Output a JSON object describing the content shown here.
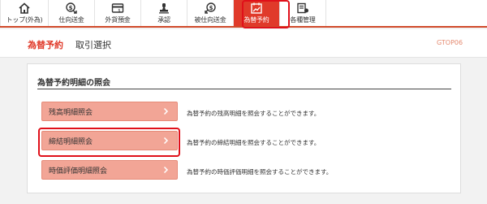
{
  "nav": {
    "items": [
      {
        "label": "トップ(外為)",
        "icon": "home-icon"
      },
      {
        "label": "仕向送金",
        "icon": "dollar-arrow-icon"
      },
      {
        "label": "外貨預金",
        "icon": "card-icon"
      },
      {
        "label": "承認",
        "icon": "stamp-icon"
      },
      {
        "label": "被仕向送金",
        "icon": "dollar-in-icon"
      },
      {
        "label": "為替予約",
        "icon": "calendar-chart-icon"
      },
      {
        "label": "各種管理",
        "icon": "management-icon"
      }
    ],
    "active_index": 5
  },
  "subheader": {
    "title": "為替予約",
    "step": "取引選択",
    "code": "GTOP06"
  },
  "panel": {
    "title": "為替予約明細の照会",
    "menu": [
      {
        "label": "残高明細照会",
        "desc": "為替予約の残高明細を照会することができます。"
      },
      {
        "label": "締結明細照会",
        "desc": "為替予約の締結明細を照会することができます。"
      },
      {
        "label": "時価評価明細照会",
        "desc": "為替予約の時価評価明細を照会することができます。"
      }
    ]
  },
  "colors": {
    "accent": "#e03a2a",
    "button_fill": "#f2a596",
    "highlight": "#e0101a"
  }
}
